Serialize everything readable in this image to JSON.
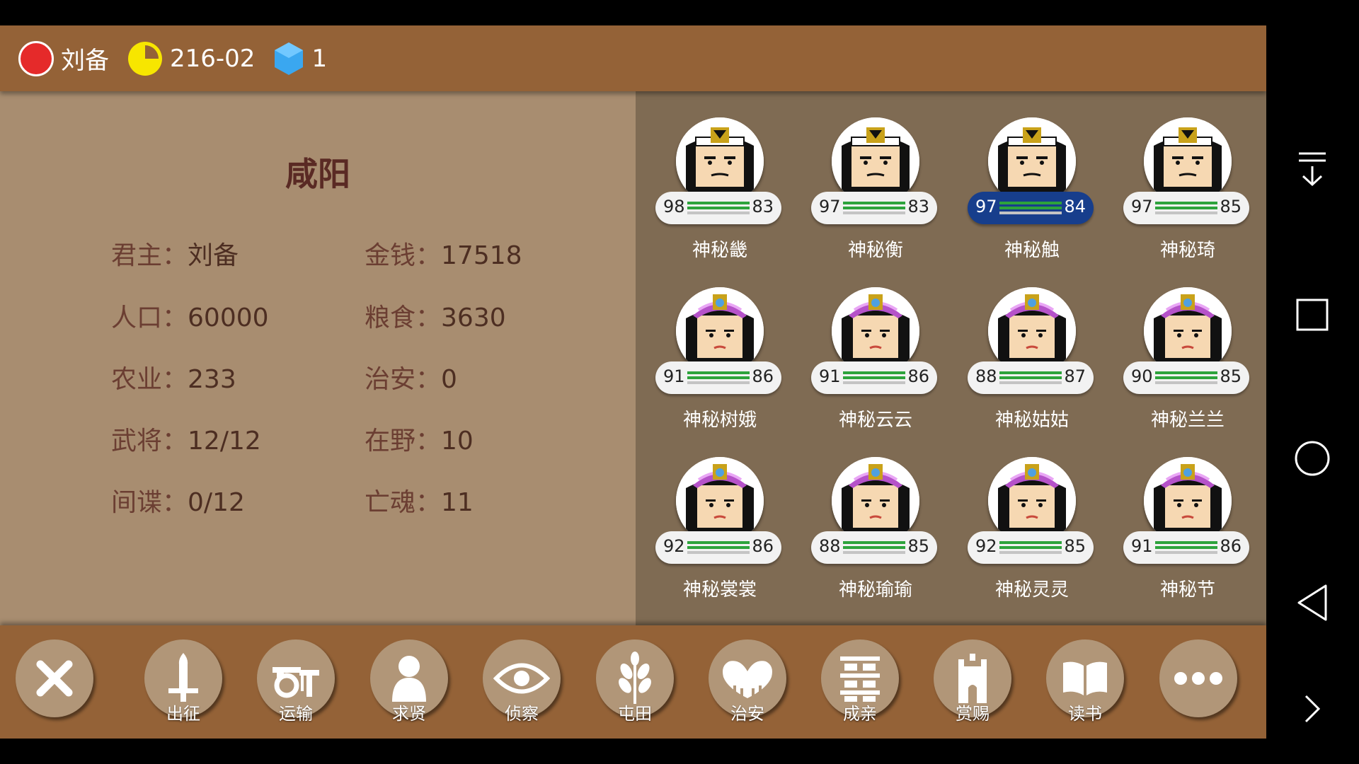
{
  "header": {
    "ruler_name": "刘备",
    "date": "216-02",
    "gems": "1"
  },
  "city": {
    "name": "咸阳",
    "stats": [
      {
        "label": "君主：",
        "value": "刘备"
      },
      {
        "label": "金钱：",
        "value": "17518"
      },
      {
        "label": "人口：",
        "value": "60000"
      },
      {
        "label": "粮食：",
        "value": "3630"
      },
      {
        "label": "农业：",
        "value": "233"
      },
      {
        "label": "治安：",
        "value": "0"
      },
      {
        "label": "武将：",
        "value": "12/12"
      },
      {
        "label": "在野：",
        "value": "10"
      },
      {
        "label": "间谍：",
        "value": "0/12"
      },
      {
        "label": "亡魂：",
        "value": "11"
      }
    ]
  },
  "generals": [
    {
      "name": "神秘畿",
      "v1": "98",
      "v2": "83",
      "type": "male",
      "selected": false
    },
    {
      "name": "神秘衡",
      "v1": "97",
      "v2": "83",
      "type": "male",
      "selected": false
    },
    {
      "name": "神秘触",
      "v1": "97",
      "v2": "84",
      "type": "male",
      "selected": true
    },
    {
      "name": "神秘琦",
      "v1": "97",
      "v2": "85",
      "type": "male",
      "selected": false
    },
    {
      "name": "神秘树娥",
      "v1": "91",
      "v2": "86",
      "type": "female",
      "selected": false
    },
    {
      "name": "神秘云云",
      "v1": "91",
      "v2": "86",
      "type": "female",
      "selected": false
    },
    {
      "name": "神秘姑姑",
      "v1": "88",
      "v2": "87",
      "type": "female",
      "selected": false
    },
    {
      "name": "神秘兰兰",
      "v1": "90",
      "v2": "85",
      "type": "female",
      "selected": false
    },
    {
      "name": "神秘裳裳",
      "v1": "92",
      "v2": "86",
      "type": "female",
      "selected": false
    },
    {
      "name": "神秘瑜瑜",
      "v1": "88",
      "v2": "85",
      "type": "female",
      "selected": false
    },
    {
      "name": "神秘灵灵",
      "v1": "92",
      "v2": "85",
      "type": "female",
      "selected": false
    },
    {
      "name": "神秘节",
      "v1": "91",
      "v2": "86",
      "type": "female",
      "selected": false
    }
  ],
  "actions": [
    {
      "label": "",
      "icon": "close-icon"
    },
    {
      "label": "出征",
      "icon": "sword-icon"
    },
    {
      "label": "运输",
      "icon": "cart-icon"
    },
    {
      "label": "求贤",
      "icon": "person-icon"
    },
    {
      "label": "侦察",
      "icon": "eye-icon"
    },
    {
      "label": "屯田",
      "icon": "wheat-icon"
    },
    {
      "label": "治安",
      "icon": "shield-heart-icon"
    },
    {
      "label": "成亲",
      "icon": "double-happiness-icon"
    },
    {
      "label": "赏赐",
      "icon": "tower-icon"
    },
    {
      "label": "读书",
      "icon": "book-icon"
    },
    {
      "label": "",
      "icon": "more-icon"
    }
  ],
  "colors": {
    "bar_brown": "#946237",
    "left_panel": "#a88d70",
    "right_panel": "#7f6b53",
    "ruler_red": "#e52a2a",
    "clock_yellow": "#f7e600",
    "gem_blue": "#3aa7f0",
    "selected_blue": "#173e8c",
    "stat_green": "#2da33c"
  },
  "system_nav": [
    "collapse-icon",
    "recents-icon",
    "home-icon",
    "back-icon",
    "next-icon"
  ]
}
